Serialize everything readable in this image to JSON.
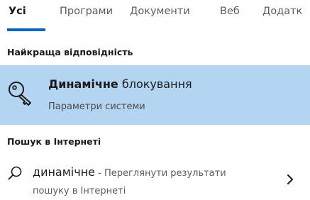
{
  "tabs": [
    {
      "label": "Усі"
    },
    {
      "label": "Програми"
    },
    {
      "label": "Документи"
    },
    {
      "label": "Веб"
    },
    {
      "label": "Додатк"
    }
  ],
  "active_tab": "Усі",
  "accent_color": "#0a63c9",
  "selection_color": "#b3d5f1",
  "best_match": {
    "header": "Найкраща відповідність",
    "title_bold": "Динамічне",
    "title_rest": " блокування",
    "subtitle": "Параметри системи",
    "icon": "key-icon"
  },
  "web_search": {
    "header": "Пошук в Інтернеті",
    "query": "динамічне",
    "suffix_line1": " - Переглянути результати",
    "suffix_line2": "пошуку в Інтернеті",
    "icon": "search-icon",
    "arrow_icon": "chevron-right-icon"
  }
}
